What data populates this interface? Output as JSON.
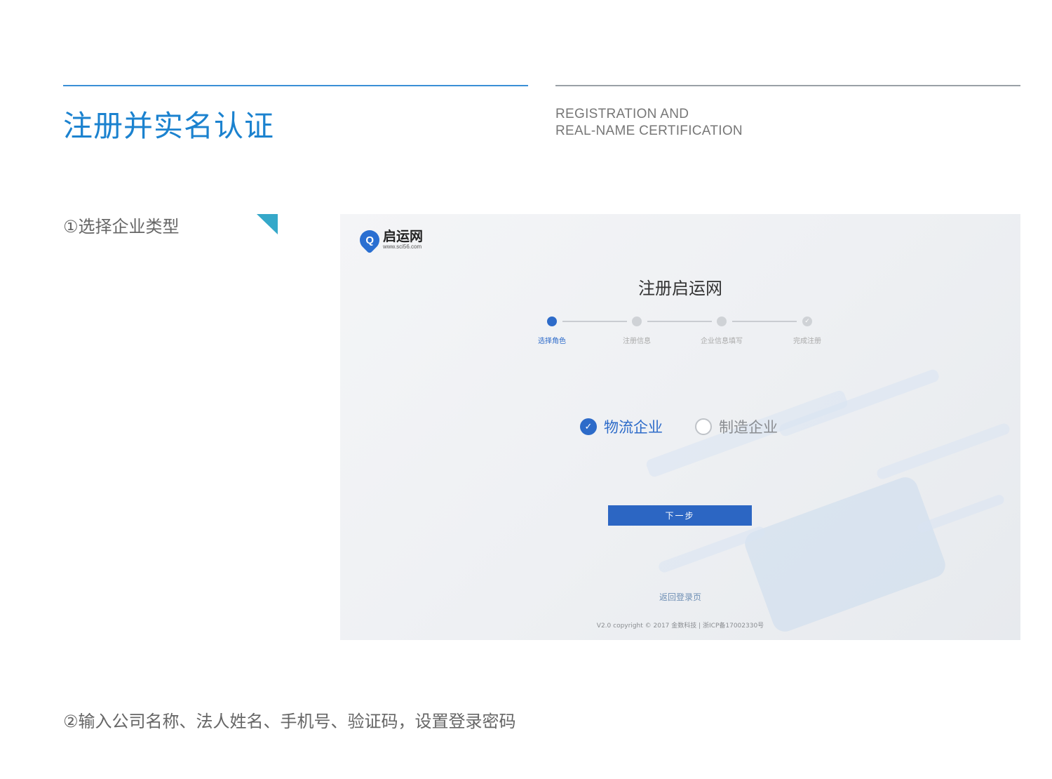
{
  "header": {
    "title_cn": "注册并实名认证",
    "title_en_line1": "REGISTRATION AND",
    "title_en_line2": "REAL-NAME CERTIFICATION"
  },
  "steps": {
    "step1_label": "①选择企业类型",
    "step2_label": "②输入公司名称、法人姓名、手机号、验证码，设置登录密码"
  },
  "panel": {
    "logo_name": "启运网",
    "logo_url": "www.sci56.com",
    "page_title": "注册启运网",
    "progress": [
      "选择角色",
      "注册信息",
      "企业信息填写",
      "完成注册"
    ],
    "options": [
      {
        "label": "物流企业",
        "checked": true
      },
      {
        "label": "制造企业",
        "checked": false
      }
    ],
    "next_button": "下一步",
    "back_link": "返回登录页",
    "copyright": "V2.0 copyright © 2017 金数科技 | 浙ICP备17002330号"
  },
  "colors": {
    "accent": "#1b82cf",
    "primary_button": "#2c66c3",
    "corner_mark": "#35a8c9"
  },
  "icons": {
    "logo": "q-pin-logo-icon",
    "checked": "checkmark-icon",
    "done_step": "check-circle-icon",
    "corner": "triangle-corner-icon"
  }
}
